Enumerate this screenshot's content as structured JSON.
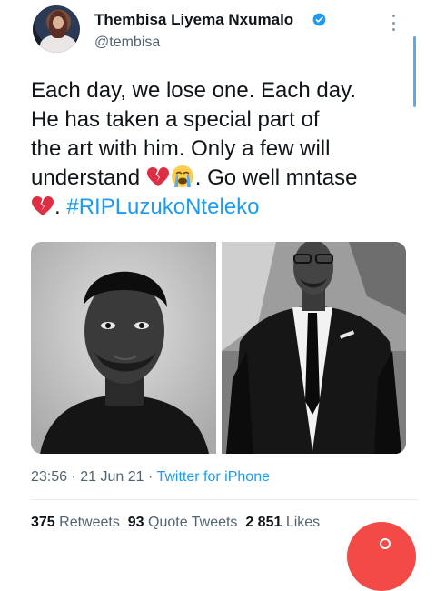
{
  "author": {
    "name": "Thembisa Liyema Nxumalo",
    "handle": "@tembisa",
    "verified": true
  },
  "tweet": {
    "line1": "Each day, we lose one. Each day.",
    "line2": "He has taken a special part of",
    "line3": "the art with him. Only a few will",
    "line4_before": "understand ",
    "line4_after": ". Go well mntase",
    "line5_after": ". ",
    "hashtag": "#RIPLuzukoNteleko",
    "emojis": [
      "broken-heart-icon",
      "loudly-crying-face-icon",
      "broken-heart-icon"
    ]
  },
  "meta": {
    "time": "23:56",
    "sep1": " · ",
    "date": "21 Jun 21",
    "sep2": " · ",
    "source": "Twitter for iPhone"
  },
  "stats": {
    "retweets_count": "375",
    "retweets_label": "Retweets",
    "quotes_count": "93",
    "quotes_label": "Quote Tweets",
    "likes_count": "2 851",
    "likes_label": "Likes"
  },
  "colors": {
    "link": "#1d9bf0",
    "secondary_text": "#536471",
    "fab": "#f44a47",
    "scrollbar": "#5fa8e8"
  }
}
